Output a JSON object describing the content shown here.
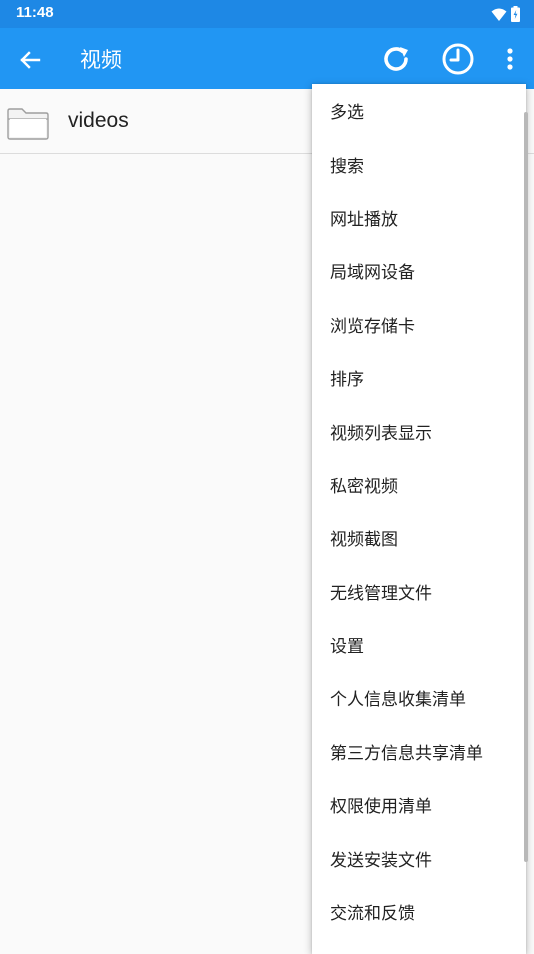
{
  "status_bar": {
    "time": "11:48",
    "icons": [
      "wifi-icon",
      "battery-icon"
    ]
  },
  "app_bar": {
    "title": "视频",
    "actions": [
      "back-arrow-icon",
      "refresh-icon",
      "history-clock-icon",
      "overflow-menu-icon"
    ]
  },
  "file_list": {
    "items": [
      {
        "name": "videos",
        "icon": "folder-icon"
      }
    ]
  },
  "overflow_menu": {
    "items": [
      "多选",
      "搜索",
      "网址播放",
      "局域网设备",
      "浏览存储卡",
      "排序",
      "视频列表显示",
      "私密视频",
      "视频截图",
      "无线管理文件",
      "设置",
      "个人信息收集清单",
      "第三方信息共享清单",
      "权限使用清单",
      "发送安装文件",
      "交流和反馈"
    ]
  },
  "colors": {
    "app_bar": "#2196f3",
    "status_bar": "#1e88e5",
    "background": "#fafafa",
    "menu_background": "#ffffff"
  }
}
